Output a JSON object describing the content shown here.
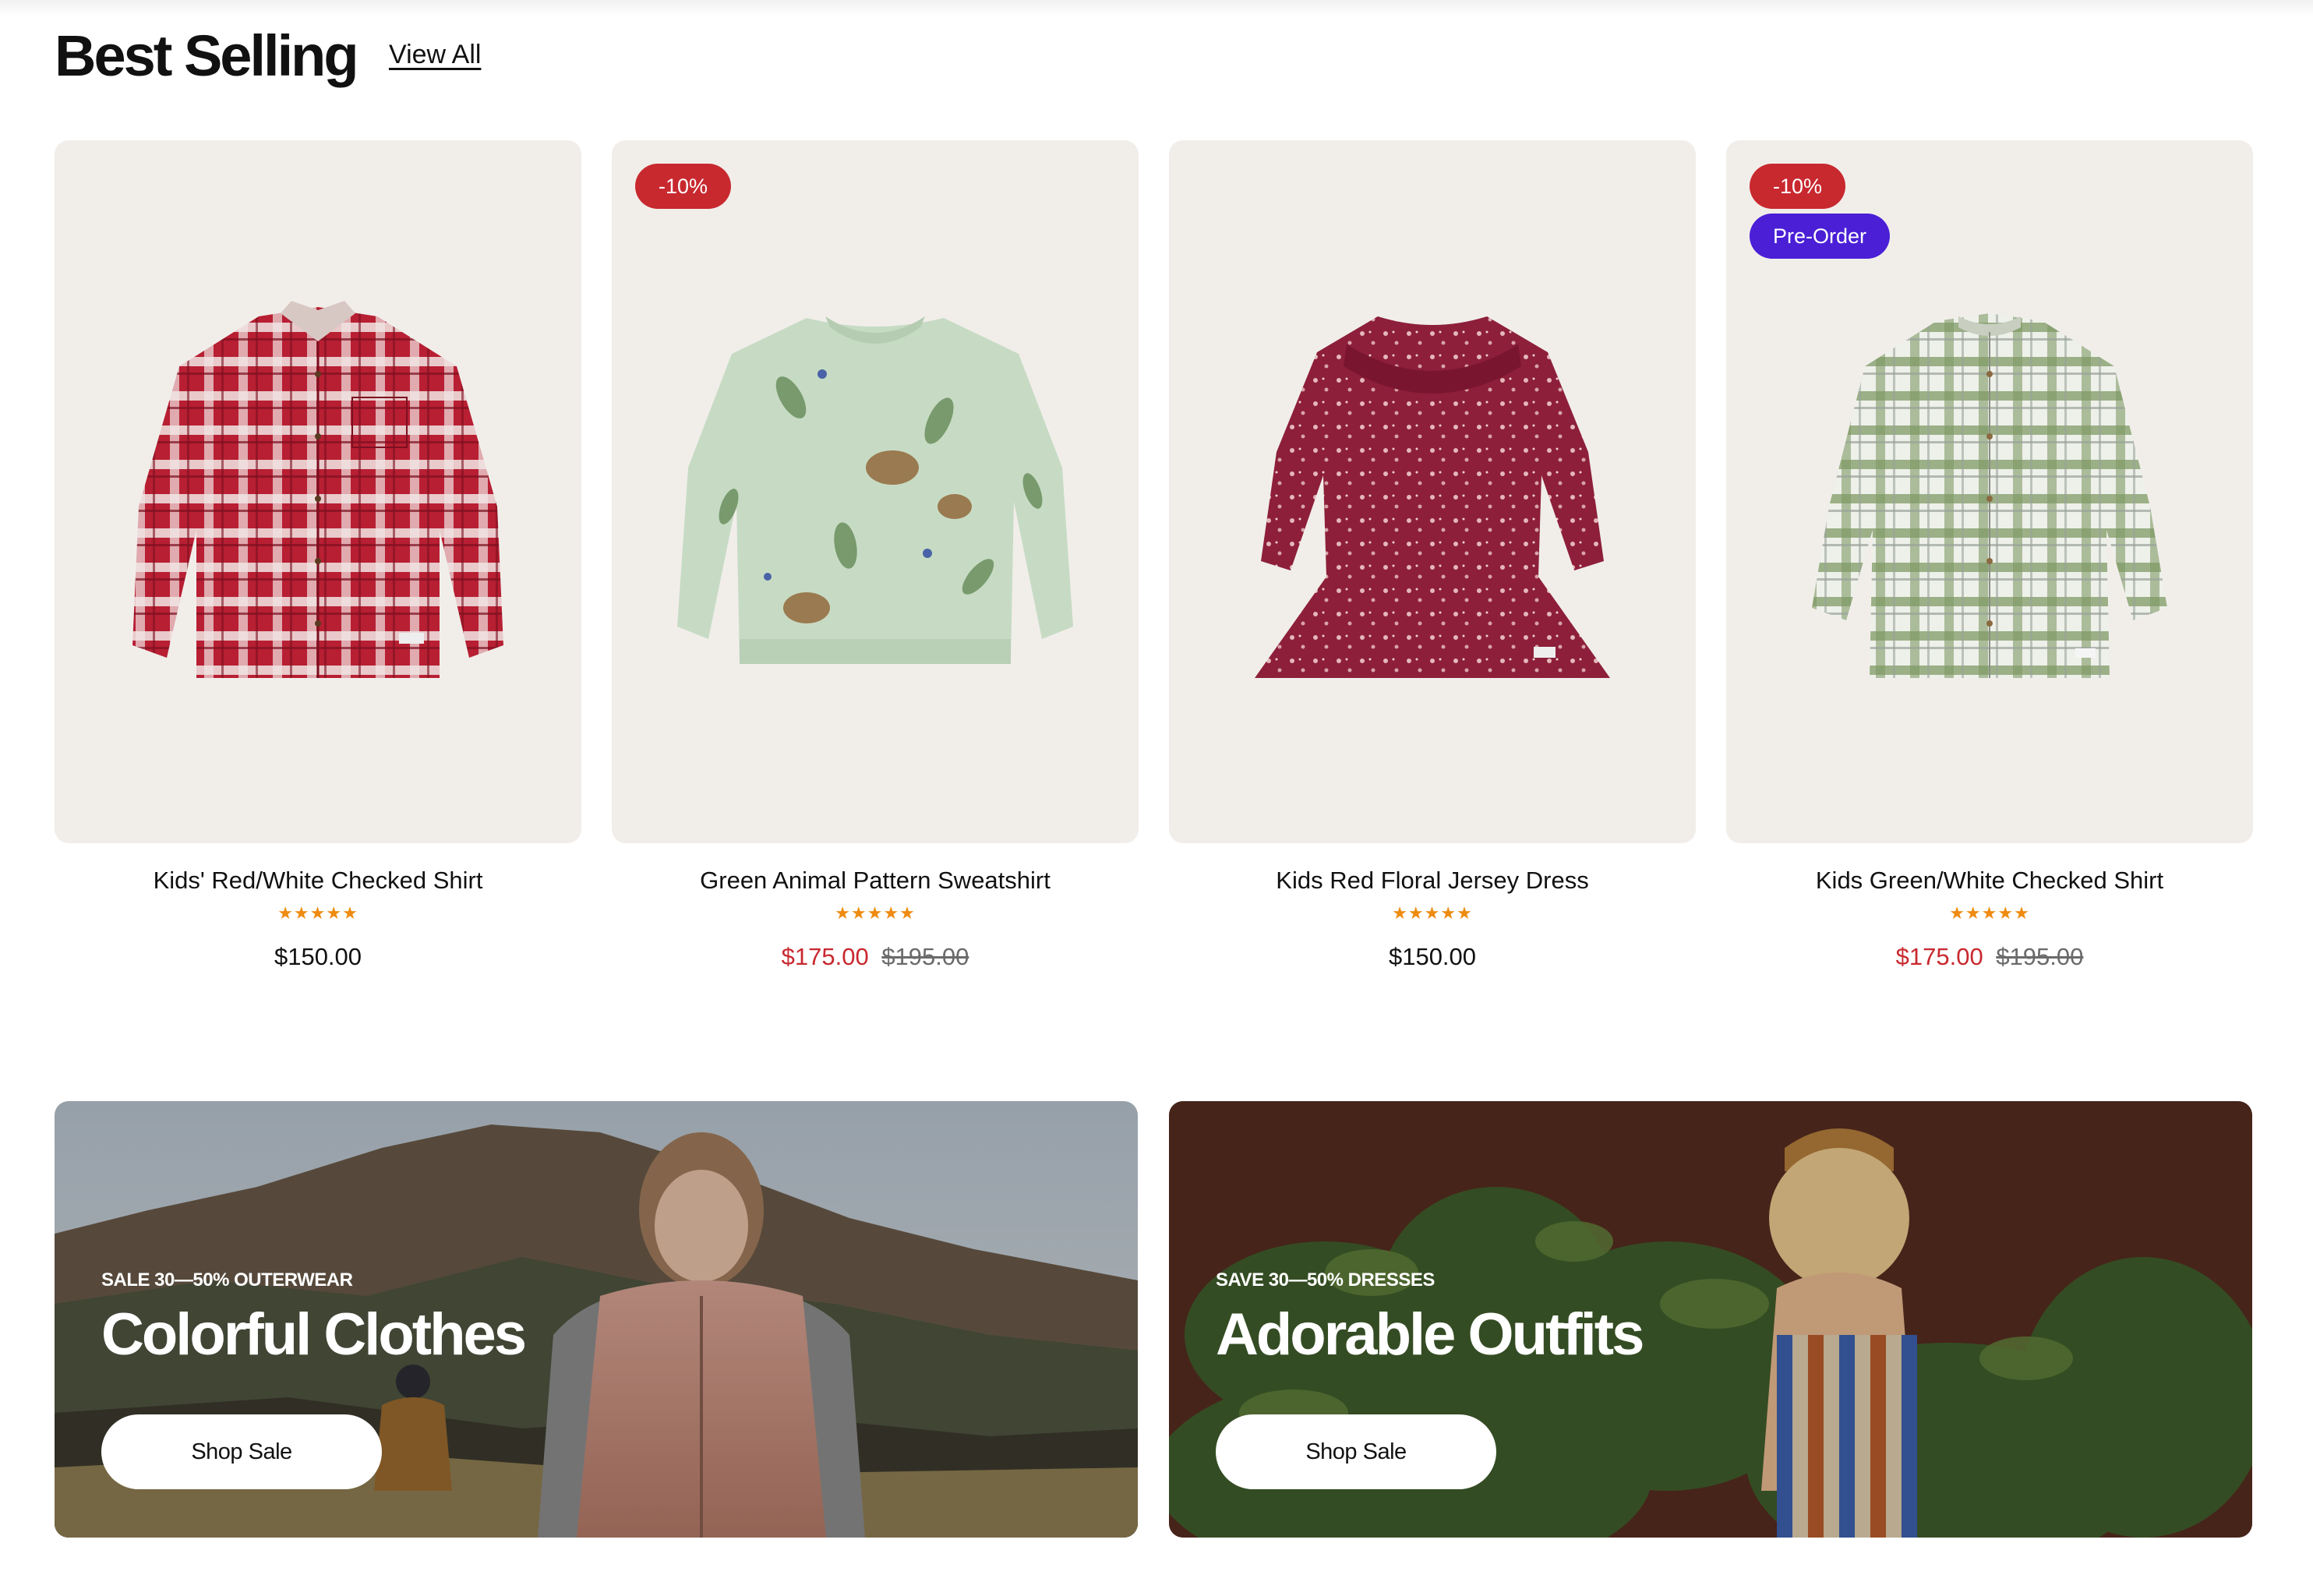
{
  "section": {
    "title": "Best Selling",
    "view_all": "View All"
  },
  "products": [
    {
      "name": "Kids' Red/White Checked Shirt",
      "rating": "★★★★★",
      "price": "$150.00",
      "sale_price": "",
      "old_price": "",
      "badges": []
    },
    {
      "name": "Green Animal Pattern Sweatshirt",
      "rating": "★★★★★",
      "price": "",
      "sale_price": "$175.00",
      "old_price": "$195.00",
      "badges": [
        "-10%"
      ]
    },
    {
      "name": "Kids Red Floral Jersey Dress",
      "rating": "★★★★★",
      "price": "$150.00",
      "sale_price": "",
      "old_price": "",
      "badges": []
    },
    {
      "name": "Kids Green/White Checked Shirt",
      "rating": "★★★★★",
      "price": "",
      "sale_price": "$175.00",
      "old_price": "$195.00",
      "badges": [
        "-10%",
        "Pre-Order"
      ]
    }
  ],
  "banners": [
    {
      "eyebrow": "SALE 30—50% OUTERWEAR",
      "headline": "Colorful Clothes",
      "cta": "Shop Sale"
    },
    {
      "eyebrow": "SAVE 30—50% DRESSES",
      "headline": "Adorable Outfits",
      "cta": "Shop Sale"
    }
  ],
  "colors": {
    "sale": "#c8292f",
    "discount_badge": "#c8292f",
    "preorder_badge": "#4a1fd6",
    "stars": "#ee8b10",
    "card_bg": "#f1eeea"
  },
  "icons": [
    "star-icon"
  ]
}
